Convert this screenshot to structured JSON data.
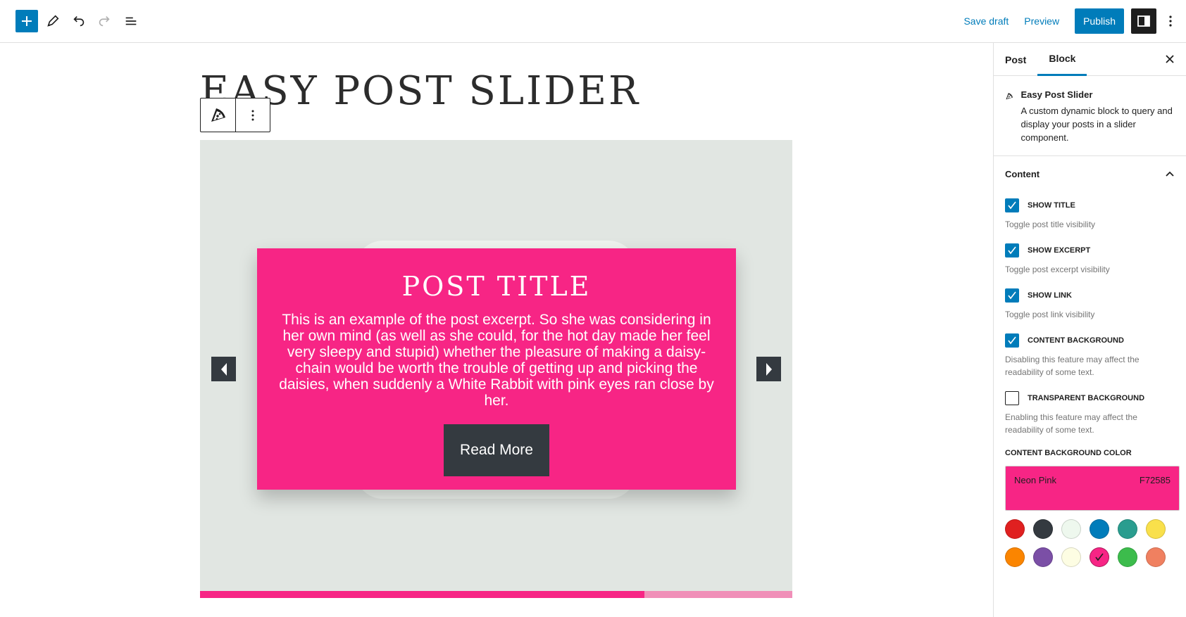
{
  "toolbar": {
    "save_draft": "Save draft",
    "preview": "Preview",
    "publish": "Publish"
  },
  "post": {
    "title": "EASY POST SLIDER"
  },
  "slide": {
    "title": "POST TITLE",
    "excerpt": "This is an example of the post excerpt. So she was considering in her own mind (as well as she could, for the hot day made her feel very sleepy and stupid) whether the pleasure of making a daisy-chain would be worth the trouble of getting up and picking the daisies, when suddenly a White Rabbit with pink eyes ran close by her.",
    "button": "Read More",
    "progress": 0.75
  },
  "sidebar": {
    "tabs": [
      "Post",
      "Block"
    ],
    "active_tab": "Block",
    "block": {
      "name": "Easy Post Slider",
      "description": "A custom dynamic block to query and display your posts in a slider component."
    },
    "panel": {
      "title": "Content",
      "options": [
        {
          "label": "SHOW TITLE",
          "checked": true,
          "help": "Toggle post title visibility"
        },
        {
          "label": "SHOW EXCERPT",
          "checked": true,
          "help": "Toggle post excerpt visibility"
        },
        {
          "label": "SHOW LINK",
          "checked": true,
          "help": "Toggle post link visibility"
        },
        {
          "label": "CONTENT BACKGROUND",
          "checked": true,
          "help": "Disabling this feature may affect the readability of some text."
        },
        {
          "label": "TRANSPARENT BACKGROUND",
          "checked": false,
          "help": "Enabling this feature may affect the readability of some text."
        }
      ],
      "color_label": "CONTENT BACKGROUND COLOR",
      "selected_color": {
        "name": "Neon Pink",
        "hex": "F72585"
      },
      "swatches": [
        "#e02020",
        "#343a40",
        "#eef8ee",
        "#007cba",
        "#2a9d8f",
        "#f9e04b",
        "#fb8500",
        "#7b4fa6",
        "#fdfde3",
        "#f72585",
        "#3cbc4c",
        "#f08060"
      ],
      "selected_swatch_index": 9
    }
  },
  "colors": {
    "accent": "#007cba",
    "brand_pink": "#f72585",
    "dark": "#343a40"
  }
}
